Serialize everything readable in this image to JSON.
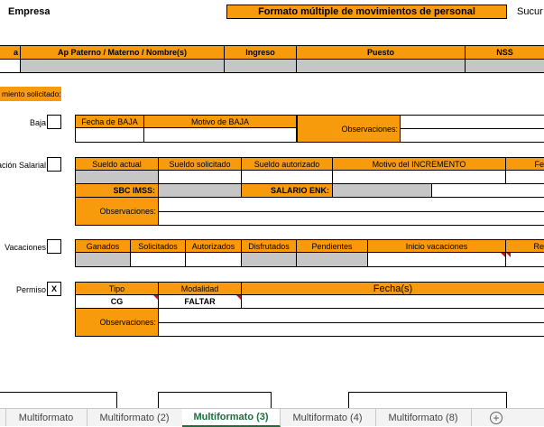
{
  "header": {
    "company": "Empresa",
    "title": "Formato múltiple de movimientos de personal",
    "branch": "Sucur"
  },
  "employee_table": {
    "col_name_partial": "a",
    "col_fullname": "Ap Paterno / Materno / Nombre(s)",
    "col_ingreso": "Ingreso",
    "col_puesto": "Puesto",
    "col_nss": "NSS"
  },
  "movement_label": "miento solicitado:",
  "baja": {
    "label": "Baja",
    "checked": "",
    "col_fecha": "Fecha de BAJA",
    "col_motivo": "Motivo de BAJA",
    "observaciones": "Observaciones:"
  },
  "salarial": {
    "label": "ación Salarial",
    "checked": "",
    "col_actual": "Sueldo actual",
    "col_solicitado": "Sueldo solicitado",
    "col_autorizado": "Sueldo autorizado",
    "col_motivo": "Motivo del INCREMENTO",
    "col_fe": "Fe",
    "sbc_label": "SBC IMSS:",
    "enk_label": "SALARIO ENK:",
    "observaciones": "Observaciones:"
  },
  "vacaciones": {
    "label": "Vacaciones",
    "checked": "",
    "col_ganados": "Ganados",
    "col_solicitados": "Solicitados",
    "col_autorizados": "Autorizados",
    "col_disfrutados": "Disfrutados",
    "col_pendientes": "Pendientes",
    "col_inicio": "Inicio vacaciones",
    "col_re": "Re"
  },
  "permiso": {
    "label": "Permiso",
    "checked": "X",
    "col_tipo": "Tipo",
    "col_modalidad": "Modalidad",
    "col_fechas": "Fecha(s)",
    "tipo_value": "CG",
    "modalidad_value": "FALTAR",
    "observaciones": "Observaciones:"
  },
  "sheet_tabs": [
    {
      "label": "Multiformato"
    },
    {
      "label": "Multiformato (2)"
    },
    {
      "label": "Multiformato (3)"
    },
    {
      "label": "Multiformato (4)"
    },
    {
      "label": "Multiformato (8)"
    }
  ],
  "add_sheet": "+",
  "colors": {
    "orange": "#f79a0c",
    "gray": "#c6c6c6",
    "active_tab": "#1e6e3c"
  }
}
